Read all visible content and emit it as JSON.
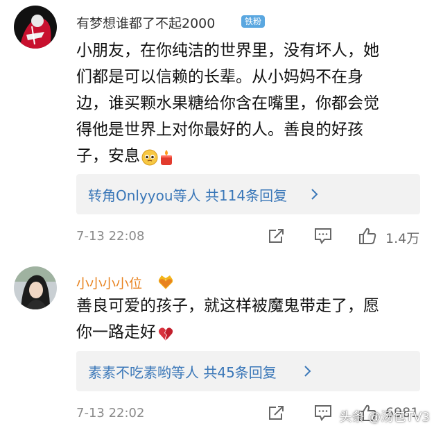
{
  "comments": [
    {
      "username": "有梦想谁都了不起2000",
      "badge": "铁粉",
      "body_lines": [
        "小朋友，在你纯洁的世界里，没有坏人，她",
        "们都是可以信赖的长辈。从小妈妈不在身",
        "边，谁买颗水果糖给你含在嘴里，你都会觉",
        "得他是世界上对你最好的人。善良的好孩",
        "子，安息"
      ],
      "emoji": [
        "pleading-face-icon",
        "candle-icon"
      ],
      "replies": {
        "text": "转角Onlyyou等人 共114条回复"
      },
      "time": "7-13 22:08",
      "likes": "1.4万"
    },
    {
      "username": "小小小小位",
      "username_color": "#e8821e",
      "badge_icon": "crown-heart-icon",
      "body_lines": [
        "善良可爱的孩子，就这样被魔鬼带走了，愿",
        "你一路走好"
      ],
      "emoji": [
        "broken-heart-icon"
      ],
      "replies": {
        "text": "素素不吃素哟等人 共45条回复"
      },
      "time": "7-13 22:02",
      "likes": "6981"
    }
  ],
  "watermark": {
    "label": "头条 @汤包TV3"
  },
  "colors": {
    "link_blue": "#3a77b8",
    "meta_gray": "#8a8a8a",
    "reply_bg": "#f2f2f2",
    "badge_blue": "#5aa7e0",
    "vip_orange": "#e8821e"
  }
}
